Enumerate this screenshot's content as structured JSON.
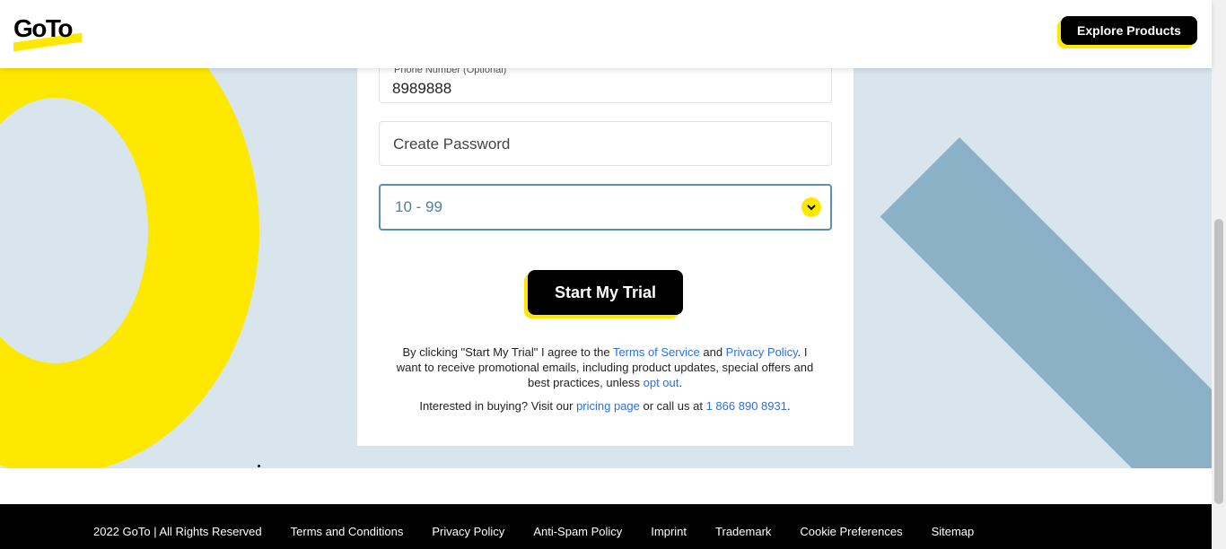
{
  "header": {
    "logo_text": "GoTo",
    "explore_label": "Explore Products"
  },
  "form": {
    "phone_label": "Phone Number (Optional)",
    "phone_value": "8989888",
    "password_placeholder": "Create Password",
    "employees_selected": "10 - 99",
    "submit_label": "Start My Trial"
  },
  "legal": {
    "pre": "By clicking \"Start My Trial\" I agree to the ",
    "terms_link": "Terms of Service",
    "and": " and ",
    "privacy_link": "Privacy Policy",
    "post": ". I want to receive promotional emails, including product updates, special offers and best practices, unless ",
    "optout_link": "opt out",
    "end": "."
  },
  "buy": {
    "pre": "Interested in buying? Visit our ",
    "pricing_link": "pricing page",
    "mid": " or call us at ",
    "phone_link": "1 866 890 8931",
    "end": "."
  },
  "footer": {
    "copyright": "2022 GoTo | All Rights Reserved",
    "links": [
      "Terms and Conditions",
      "Privacy Policy",
      "Anti-Spam Policy",
      "Imprint",
      "Trademark",
      "Cookie Preferences",
      "Sitemap"
    ]
  },
  "colors": {
    "brand_yellow": "#ffe800",
    "hero_bg": "#d8e5ec",
    "stripe_blue": "#8ab1c6",
    "link_blue": "#2f6fd6"
  },
  "icons": {
    "select_chevron": "chevron-down-icon"
  }
}
